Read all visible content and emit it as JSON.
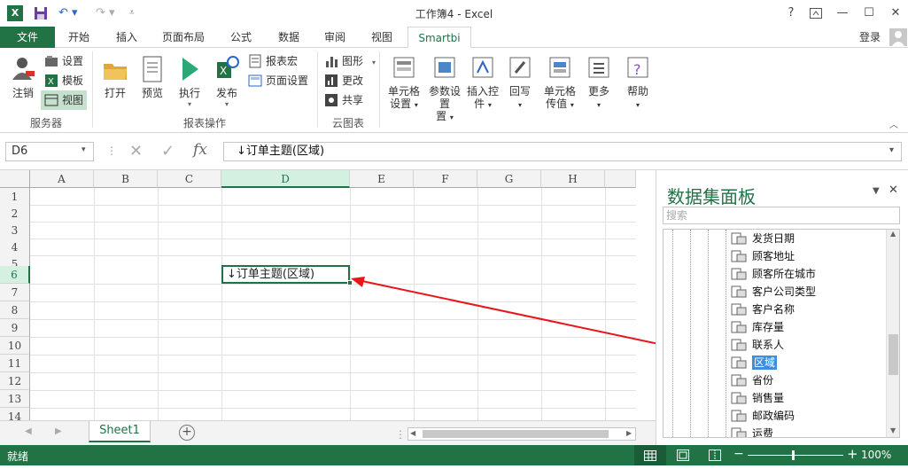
{
  "titlebar": {
    "title": "工作簿4 - Excel",
    "help": "?",
    "restore": "□",
    "minimize": "—",
    "maximize": "☐",
    "close": "✕"
  },
  "tabs": [
    {
      "label": "文件"
    },
    {
      "label": "开始"
    },
    {
      "label": "插入"
    },
    {
      "label": "页面布局"
    },
    {
      "label": "公式"
    },
    {
      "label": "数据"
    },
    {
      "label": "审阅"
    },
    {
      "label": "视图"
    },
    {
      "label": "Smartbi"
    }
  ],
  "login": "登录",
  "ribbon": {
    "groups": {
      "server": "服务器",
      "report_ops": "报表操作",
      "cloud": "云图表"
    },
    "logout": "注销",
    "settings": "设置",
    "template": "模板",
    "view": "视图",
    "open": "打开",
    "preview": "预览",
    "execute": "执行",
    "publish": "发布",
    "report_macro": "报表宏",
    "page_setup": "页面设置",
    "graph": "图形",
    "update": "更改",
    "share": "共享",
    "cell_settings": "单元格",
    "cell_settings2": "设置",
    "param_settings": "参数设置",
    "param_settings2": "置",
    "insert_control": "插入控",
    "insert_control2": "件",
    "writeback": "回写",
    "cell_pass": "单元格",
    "cell_pass2": "传值",
    "more": "更多",
    "help": "帮助"
  },
  "formula_bar": {
    "name_box": "D6",
    "formula": "↓订单主题(区域)",
    "fx": "fx"
  },
  "grid": {
    "columns": [
      "A",
      "B",
      "C",
      "D",
      "E",
      "F",
      "G",
      "H"
    ],
    "rows": [
      "1",
      "2",
      "3",
      "4",
      "5",
      "6",
      "7",
      "8",
      "9",
      "10",
      "11",
      "12",
      "13",
      "14"
    ],
    "active_cell_value": "↓订单主题(区域)"
  },
  "sheet_tab": "Sheet1",
  "status": {
    "ready": "就绪",
    "zoom": "100%"
  },
  "panel": {
    "title": "数据集面板",
    "search_placeholder": "搜索",
    "fields": [
      "发货日期",
      "顾客地址",
      "顾客所在城市",
      "客户公司类型",
      "客户名称",
      "库存量",
      "联系人",
      "区域",
      "省份",
      "销售量",
      "邮政编码",
      "运费"
    ],
    "selected": "区域"
  },
  "colors": {
    "accent": "#217346",
    "arrow": "#e8161b",
    "selection": "#3e8ede"
  }
}
